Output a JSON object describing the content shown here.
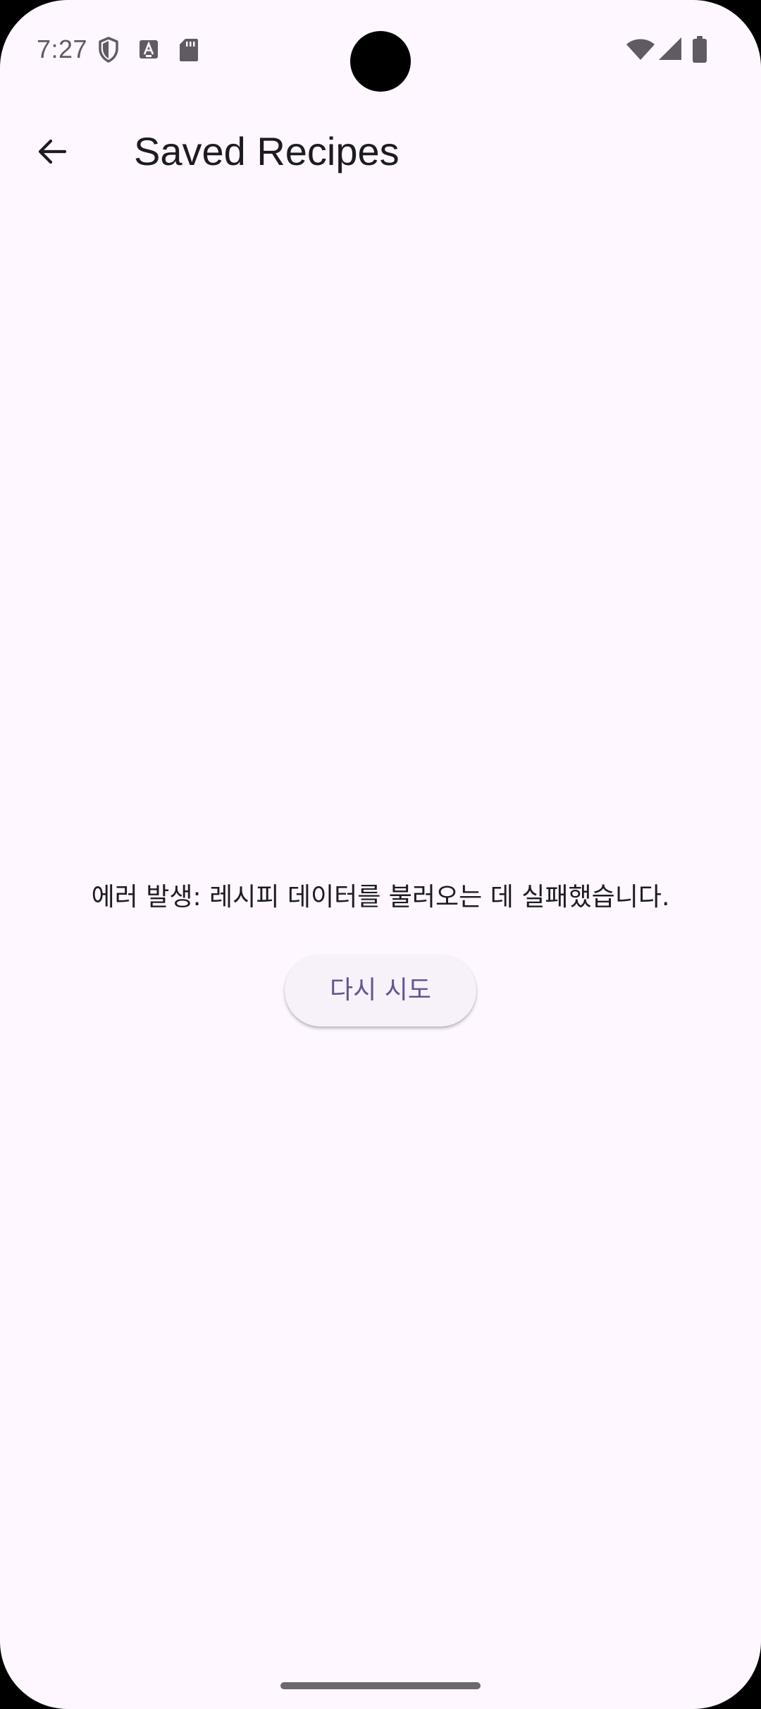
{
  "status_bar": {
    "time": "7:27",
    "left_icons": [
      "shield-icon",
      "font-app-icon",
      "sd-card-icon"
    ],
    "right_icons": [
      "wifi-icon",
      "cellular-signal-icon",
      "battery-icon"
    ]
  },
  "app_bar": {
    "back_icon": "arrow-back-icon",
    "title": "Saved Recipes"
  },
  "error": {
    "message": "에러 발생: 레시피 데이터를 불러오는 데 실패했습니다.",
    "retry_label": "다시 시도"
  },
  "colors": {
    "background": "#fef7ff",
    "title_text": "#1d1b20",
    "button_surface": "#f7f2fa",
    "button_text": "#65558f"
  }
}
